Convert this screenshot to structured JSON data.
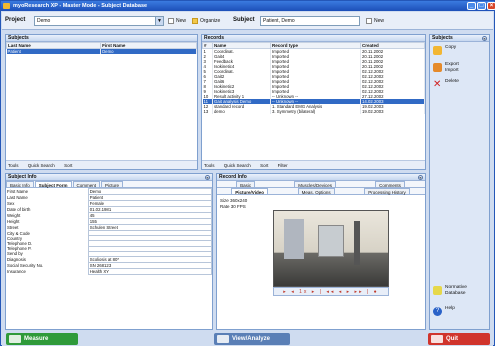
{
  "window": {
    "title": "myoResearch XP - Master Mode - Subject Database"
  },
  "toolbar": {
    "project_label": "Project",
    "project_value": "Demo",
    "new1": "New",
    "organize": "Organize",
    "subject_label": "Subject",
    "subject_value": "Patient, Demo",
    "new2": "New"
  },
  "subjects": {
    "title": "Subjects",
    "col1": "Last Name",
    "col2": "First Name",
    "rows": [
      {
        "last": "Patient",
        "first": "Demo"
      }
    ],
    "tools": "Tools",
    "quick": "Quick Search",
    "sort": "Sort"
  },
  "records": {
    "title": "Records",
    "cols": [
      "#",
      "Name",
      "Record type",
      "Created"
    ],
    "rows": [
      [
        "1",
        "Coordinat.",
        "Imported",
        "20.11.2002"
      ],
      [
        "2",
        "Gait4",
        "Imported",
        "20.11.2002"
      ],
      [
        "3",
        "Feedback",
        "Imported",
        "20.11.2002"
      ],
      [
        "4",
        "Isokinetic4",
        "Imported",
        "20.11.2002"
      ],
      [
        "5",
        "Coordinat.",
        "Imported",
        "02.12.2002"
      ],
      [
        "6",
        "Gait2",
        "Imported",
        "02.12.2002"
      ],
      [
        "7",
        "Gait6",
        "Imported",
        "02.12.2002"
      ],
      [
        "8",
        "Isokinetic2",
        "Imported",
        "02.12.2002"
      ],
      [
        "9",
        "Isokinetic3",
        "Imported",
        "02.12.2002"
      ],
      [
        "10",
        "Result activity 1",
        "-- Unknown --",
        "27.12.2002"
      ],
      [
        "11",
        "Gait analysis Demo",
        "-- Unknown --",
        "14.02.2003"
      ],
      [
        "12",
        "standard record",
        "1. Standard EMG Analysis",
        "19.02.2003"
      ],
      [
        "13",
        "demo",
        "3. Symmetry (bilateral)",
        "19.02.2003"
      ]
    ],
    "tools": "Tools",
    "quick": "Quick Search",
    "sort": "Sort",
    "filter": "Filter"
  },
  "actions": {
    "title": "Subjects",
    "copy": "Copy",
    "export": "Export",
    "import": "Import",
    "delete": "Delete",
    "normative": "Normative",
    "database": "Database",
    "help": "Help"
  },
  "subjectinfo": {
    "title": "Subject Info",
    "tabs": [
      "Basic Info",
      "Subject Form",
      "Comment",
      "Picture"
    ],
    "fields": [
      [
        "First Name",
        "Demo"
      ],
      [
        "Last Name",
        "Patient"
      ],
      [
        "Sex",
        "Female"
      ],
      [
        "Date of birth",
        "01.02.1981"
      ],
      [
        "Weight",
        "45"
      ],
      [
        "Height",
        "155"
      ],
      [
        "Street",
        "Schulen Street"
      ],
      [
        "City & Code",
        ""
      ],
      [
        "Country",
        ""
      ],
      [
        "Telephone D.",
        ""
      ],
      [
        "Telephone P.",
        ""
      ],
      [
        "Send by",
        ""
      ],
      [
        "Diagnosis",
        "Scoliosis at 80*"
      ],
      [
        "Social Security No.",
        "SN 268123"
      ],
      [
        "Insurance",
        "Health XY"
      ]
    ]
  },
  "recordinfo": {
    "title": "Record Info",
    "tabs1": [
      "Basic",
      "Muscles/Devices",
      "Comments"
    ],
    "tabs2": [
      "Picture/Video",
      "Meas. Options",
      "Processing History"
    ],
    "size": "Size  360x240",
    "rate": "Rate  30 FPS",
    "controls": "▸ ◂ 1x ▸ | ◂◂ ◂ ▸ ▸▸ | ●"
  },
  "bottom": {
    "measure": "Measure",
    "view": "View/Analyze",
    "quit": "Quit"
  }
}
